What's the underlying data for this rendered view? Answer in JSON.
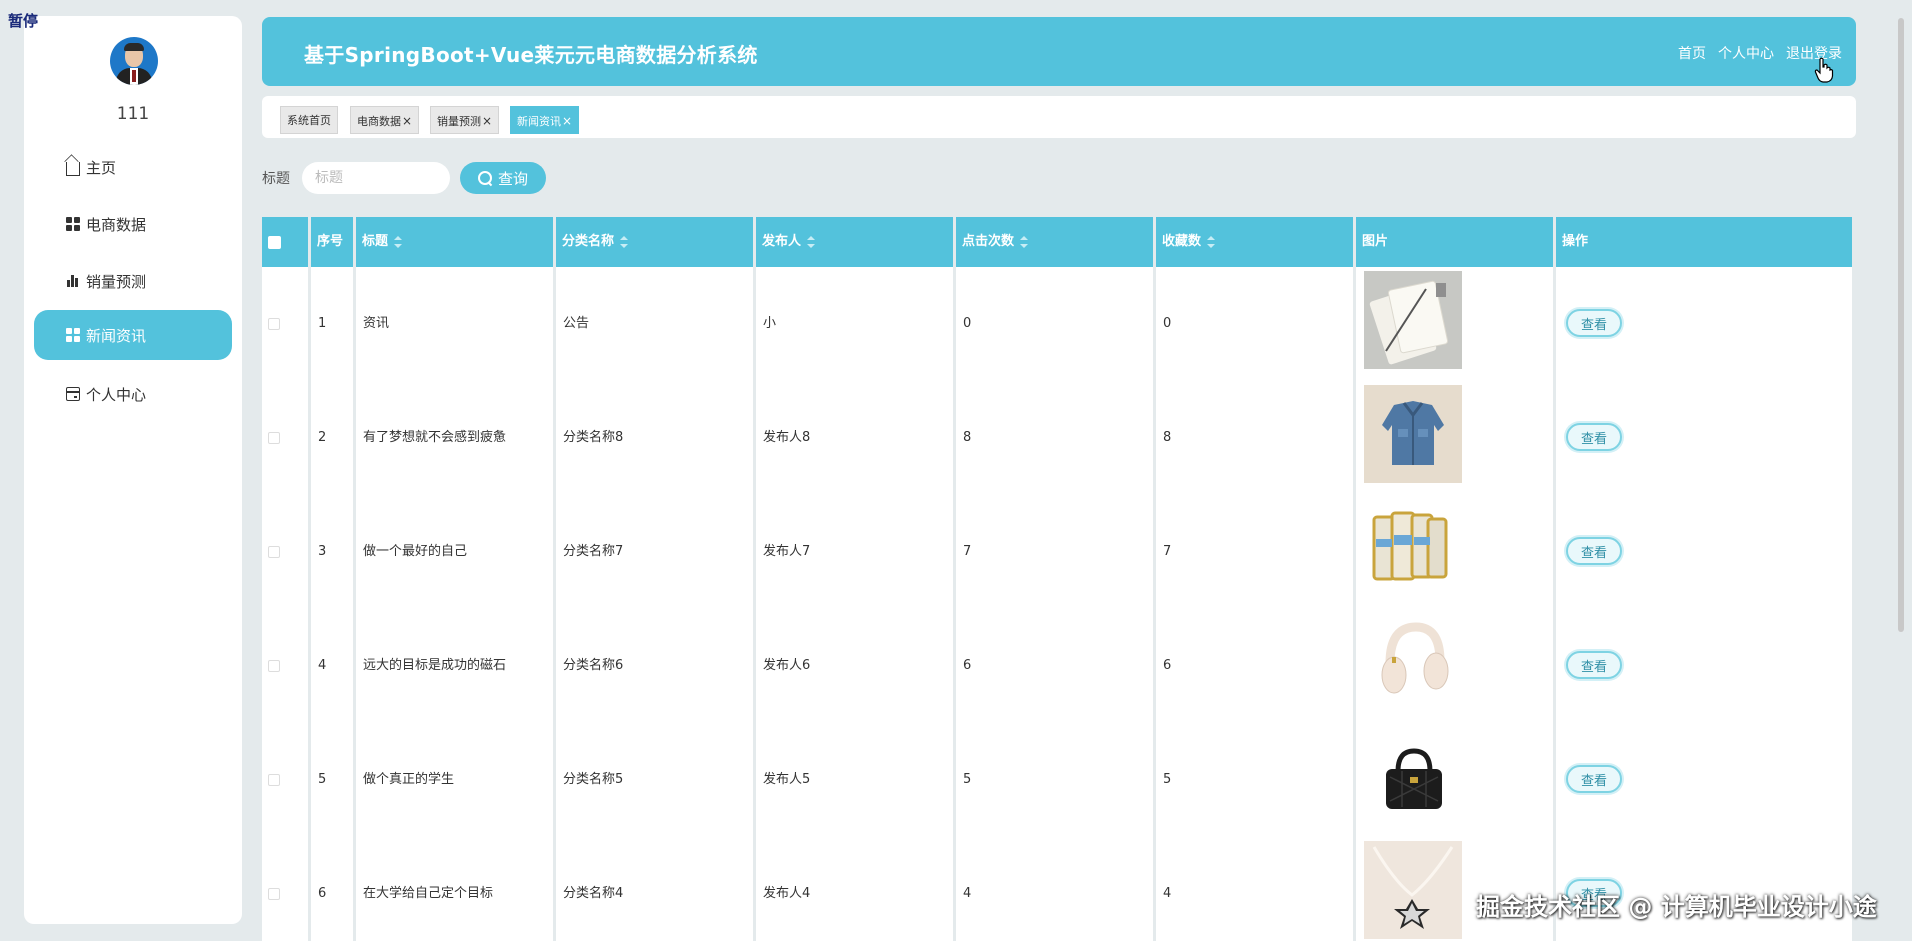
{
  "overlay": {
    "pause_text": "暂停"
  },
  "sidebar": {
    "username": "111",
    "items": [
      {
        "label": "主页",
        "icon": "home-icon"
      },
      {
        "label": "电商数据",
        "icon": "grid-icon"
      },
      {
        "label": "销量预测",
        "icon": "bar-chart-icon"
      },
      {
        "label": "新闻资讯",
        "icon": "grid-icon",
        "active": true
      },
      {
        "label": "个人中心",
        "icon": "card-icon"
      }
    ]
  },
  "header": {
    "title": "基于SpringBoot+Vue莱元元电商数据分析系统",
    "nav": {
      "home": "首页",
      "profile": "个人中心",
      "logout": "退出登录"
    }
  },
  "tabs": [
    {
      "label": "系统首页",
      "closable": false
    },
    {
      "label": "电商数据",
      "closable": true
    },
    {
      "label": "销量预测",
      "closable": true
    },
    {
      "label": "新闻资讯",
      "closable": true,
      "active": true
    }
  ],
  "search": {
    "label": "标题",
    "placeholder": "标题",
    "value": "",
    "button_label": "查询"
  },
  "table": {
    "headers": {
      "index": "序号",
      "title": "标题",
      "category": "分类名称",
      "publisher": "发布人",
      "clicks": "点击次数",
      "favorites": "收藏数",
      "image": "图片",
      "actions": "操作"
    },
    "rows": [
      {
        "index": "1",
        "title": "资讯",
        "category": "公告",
        "publisher": "小",
        "clicks": "0",
        "favorites": "0",
        "image": "notebooks",
        "action": "查看"
      },
      {
        "index": "2",
        "title": "有了梦想就不会感到疲惫",
        "category": "分类名称8",
        "publisher": "发布人8",
        "clicks": "8",
        "favorites": "8",
        "image": "denim-jacket",
        "action": "查看"
      },
      {
        "index": "3",
        "title": "做一个最好的自己",
        "category": "分类名称7",
        "publisher": "发布人7",
        "clicks": "7",
        "favorites": "7",
        "image": "milk-powder-cans",
        "action": "查看"
      },
      {
        "index": "4",
        "title": "远大的目标是成功的磁石",
        "category": "分类名称6",
        "publisher": "发布人6",
        "clicks": "6",
        "favorites": "6",
        "image": "headphones",
        "action": "查看"
      },
      {
        "index": "5",
        "title": "做个真正的学生",
        "category": "分类名称5",
        "publisher": "发布人5",
        "clicks": "5",
        "favorites": "5",
        "image": "handbag",
        "action": "查看"
      },
      {
        "index": "6",
        "title": "在大学给自己定个目标",
        "category": "分类名称4",
        "publisher": "发布人4",
        "clicks": "4",
        "favorites": "4",
        "image": "necklace",
        "action": "查看"
      }
    ]
  },
  "watermark": "掘金技术社区 @ 计算机毕业设计小途",
  "colors": {
    "accent": "#53c2dc",
    "background": "#e4eaec"
  }
}
